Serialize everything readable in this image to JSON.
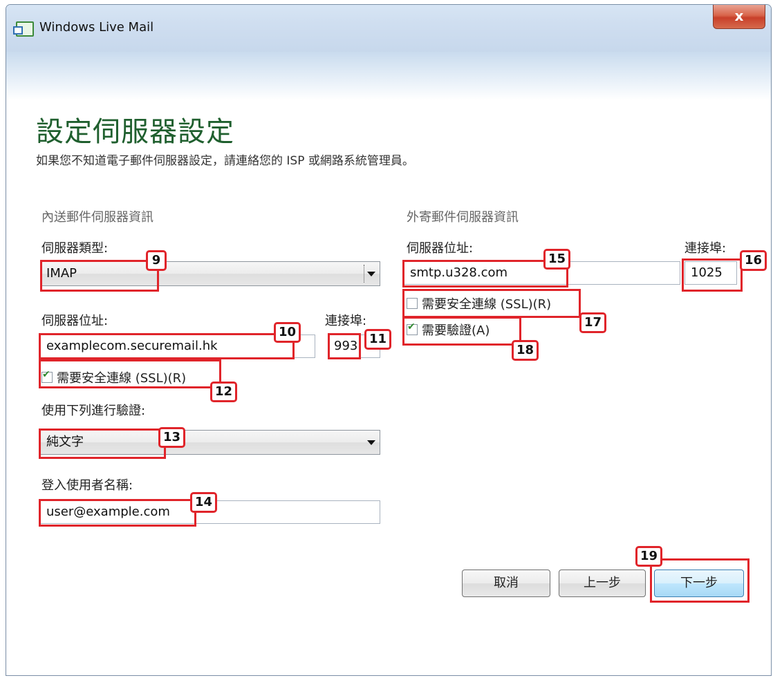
{
  "window": {
    "title": "Windows Live Mail",
    "close_label": "x"
  },
  "header": {
    "title": "設定伺服器設定",
    "subtitle": "如果您不知道電子郵件伺服器設定，請連絡您的 ISP 或網路系統管理員。"
  },
  "incoming": {
    "section_title": "內送郵件伺服器資訊",
    "server_type_label": "伺服器類型:",
    "server_type_value": "IMAP",
    "server_address_label": "伺服器位址:",
    "server_address_value": "examplecom.securemail.hk",
    "port_label": "連接埠:",
    "port_value": "993",
    "ssl_label": "需要安全連線 (SSL)(R)",
    "ssl_checked": true,
    "auth_label": "使用下列進行驗證:",
    "auth_value": "純文字",
    "username_label": "登入使用者名稱:",
    "username_value": "user@example.com"
  },
  "outgoing": {
    "section_title": "外寄郵件伺服器資訊",
    "server_address_label": "伺服器位址:",
    "server_address_value": "smtp.u328.com",
    "port_label": "連接埠:",
    "port_value": "1025",
    "ssl_label": "需要安全連線 (SSL)(R)",
    "ssl_checked": false,
    "auth_label": "需要驗證(A)",
    "auth_checked": true
  },
  "buttons": {
    "cancel": "取消",
    "back": "上一步",
    "next": "下一步"
  },
  "annotations": [
    "9",
    "10",
    "11",
    "12",
    "13",
    "14",
    "15",
    "16",
    "17",
    "18",
    "19"
  ],
  "colors": {
    "annotation": "#e0242a",
    "heading": "#1f5f2e",
    "checkmark": "#2f8a2f"
  }
}
